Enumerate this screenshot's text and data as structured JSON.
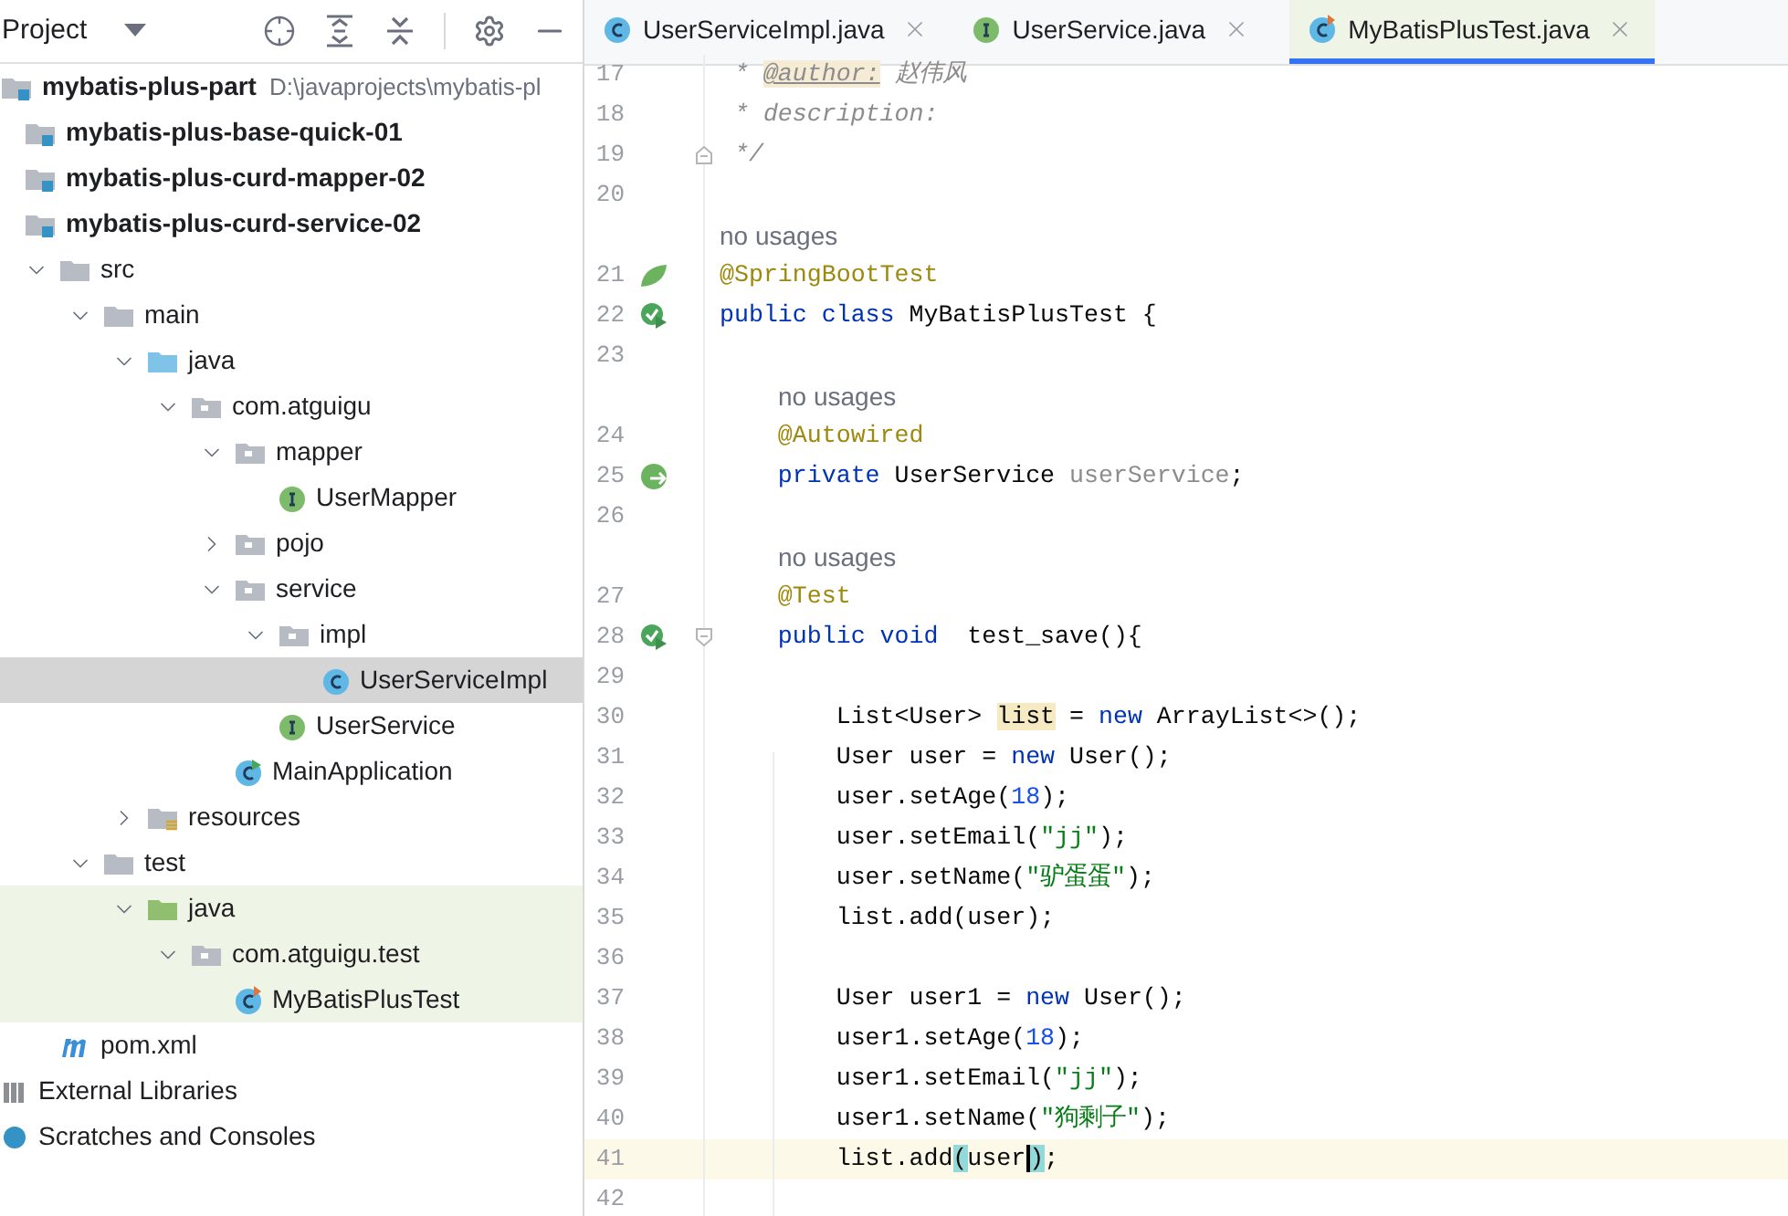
{
  "project_panel": {
    "title": "Project",
    "tree": [
      {
        "label": "mybatis-plus-part",
        "path": "D:\\javaprojects\\mybatis-pl",
        "kind": "root",
        "selected": false,
        "children": [
          {
            "label": "mybatis-plus-base-quick-01",
            "kind": "module",
            "selected": false
          },
          {
            "label": "mybatis-plus-curd-mapper-02",
            "kind": "module",
            "selected": false
          },
          {
            "label": "mybatis-plus-curd-service-02",
            "kind": "module",
            "selected": false
          },
          {
            "label": "src",
            "kind": "folder",
            "expanded": true,
            "selected": false,
            "children": [
              {
                "label": "main",
                "kind": "folder",
                "expanded": true,
                "selected": false,
                "children": [
                  {
                    "label": "java",
                    "kind": "source-folder",
                    "expanded": true,
                    "selected": false,
                    "children": [
                      {
                        "label": "com.atguigu",
                        "kind": "package",
                        "expanded": true,
                        "selected": false,
                        "children": [
                          {
                            "label": "mapper",
                            "kind": "package",
                            "expanded": true,
                            "selected": false,
                            "children": [
                              {
                                "label": "UserMapper",
                                "kind": "interface",
                                "selected": false
                              }
                            ]
                          },
                          {
                            "label": "pojo",
                            "kind": "package",
                            "expanded": false,
                            "selected": false
                          },
                          {
                            "label": "service",
                            "kind": "package",
                            "expanded": true,
                            "selected": false,
                            "children": [
                              {
                                "label": "impl",
                                "kind": "package",
                                "expanded": true,
                                "selected": false,
                                "children": [
                                  {
                                    "label": "UserServiceImpl",
                                    "kind": "class",
                                    "selected": true
                                  }
                                ]
                              },
                              {
                                "label": "UserService",
                                "kind": "interface",
                                "selected": false
                              }
                            ]
                          },
                          {
                            "label": "MainApplication",
                            "kind": "spring-class",
                            "selected": false
                          }
                        ]
                      }
                    ]
                  },
                  {
                    "label": "resources",
                    "kind": "resources-folder",
                    "expanded": false,
                    "selected": false
                  }
                ]
              },
              {
                "label": "test",
                "kind": "folder",
                "expanded": true,
                "selected": false,
                "children": [
                  {
                    "label": "java",
                    "kind": "test-folder",
                    "expanded": true,
                    "selected": false,
                    "children": [
                      {
                        "label": "com.atguigu.test",
                        "kind": "package",
                        "expanded": true,
                        "selected": false,
                        "children": [
                          {
                            "label": "MyBatisPlusTest",
                            "kind": "test-class",
                            "selected": false
                          }
                        ]
                      }
                    ]
                  }
                ]
              }
            ]
          },
          {
            "label": "pom.xml",
            "kind": "maven",
            "selected": false
          }
        ]
      },
      {
        "label": "External Libraries",
        "kind": "libraries",
        "selected": false
      },
      {
        "label": "Scratches and Consoles",
        "kind": "scratches",
        "selected": false
      }
    ]
  },
  "tabs": [
    {
      "label": "UserServiceImpl.java",
      "kind": "class",
      "selected": false
    },
    {
      "label": "UserService.java",
      "kind": "interface",
      "selected": false
    },
    {
      "label": "MyBatisPlusTest.java",
      "kind": "test-class",
      "selected": true
    }
  ],
  "editor": {
    "lines": [
      {
        "kind": "code",
        "number": "17",
        "current": false,
        "tokens": [
          {
            "text": " * ",
            "kind": "comment"
          },
          {
            "text": "@author:",
            "kind": "doctag"
          },
          {
            "text": " 赵伟风",
            "kind": "comment"
          }
        ]
      },
      {
        "kind": "code",
        "number": "18",
        "current": false,
        "tokens": [
          {
            "text": " * description:",
            "kind": "comment"
          }
        ]
      },
      {
        "kind": "code",
        "number": "19",
        "current": false,
        "fold_marker": {
          "kind": "end"
        },
        "tokens": [
          {
            "text": " */",
            "kind": "comment"
          }
        ]
      },
      {
        "kind": "code",
        "number": "20"
      },
      {
        "kind": "hint",
        "text": "no usages"
      },
      {
        "kind": "code",
        "number": "21",
        "current": false,
        "gutter_icon": {
          "kind": "spring"
        },
        "tokens": [
          {
            "text": "@SpringBootTest",
            "kind": "annotation"
          }
        ]
      },
      {
        "kind": "code",
        "number": "22",
        "current": false,
        "gutter_icon": {
          "kind": "run"
        },
        "tokens": [
          {
            "text": "public class",
            "kind": "keyword"
          },
          {
            "text": " MyBatisPlusTest {",
            "kind": "plain"
          }
        ]
      },
      {
        "kind": "code",
        "number": "23"
      },
      {
        "kind": "hint",
        "text": "no usages"
      },
      {
        "kind": "code",
        "number": "24",
        "current": false,
        "tokens": [
          {
            "text": "    @Autowired",
            "kind": "annotation"
          }
        ]
      },
      {
        "kind": "code",
        "number": "25",
        "current": false,
        "gutter_icon": {
          "kind": "bean"
        },
        "tokens": [
          {
            "text": "    private",
            "kind": "keyword"
          },
          {
            "text": " UserService ",
            "kind": "plain"
          },
          {
            "text": "userService",
            "kind": "unused"
          },
          {
            "text": ";",
            "kind": "plain"
          }
        ]
      },
      {
        "kind": "code",
        "number": "26"
      },
      {
        "kind": "hint",
        "text": "no usages"
      },
      {
        "kind": "code",
        "number": "27",
        "current": false,
        "tokens": [
          {
            "text": "    @Test",
            "kind": "annotation"
          }
        ]
      },
      {
        "kind": "code",
        "number": "28",
        "current": false,
        "gutter_icon": {
          "kind": "run"
        },
        "fold_marker": {
          "kind": "start"
        },
        "tokens": [
          {
            "text": "    public void",
            "kind": "keyword"
          },
          {
            "text": "  test_save(){",
            "kind": "plain"
          }
        ]
      },
      {
        "kind": "code",
        "number": "29"
      },
      {
        "kind": "code",
        "number": "30",
        "current": false,
        "tokens": [
          {
            "text": "        List<User> ",
            "kind": "plain"
          },
          {
            "text": "list",
            "kind": "highlight"
          },
          {
            "text": " = ",
            "kind": "plain"
          },
          {
            "text": "new",
            "kind": "keyword"
          },
          {
            "text": " ArrayList<>();",
            "kind": "plain"
          }
        ]
      },
      {
        "kind": "code",
        "number": "31",
        "current": false,
        "tokens": [
          {
            "text": "        User user = ",
            "kind": "plain"
          },
          {
            "text": "new",
            "kind": "keyword"
          },
          {
            "text": " User();",
            "kind": "plain"
          }
        ]
      },
      {
        "kind": "code",
        "number": "32",
        "current": false,
        "tokens": [
          {
            "text": "        user.setAge(",
            "kind": "plain"
          },
          {
            "text": "18",
            "kind": "number"
          },
          {
            "text": ");",
            "kind": "plain"
          }
        ]
      },
      {
        "kind": "code",
        "number": "33",
        "current": false,
        "tokens": [
          {
            "text": "        user.setEmail(",
            "kind": "plain"
          },
          {
            "text": "\"jj\"",
            "kind": "string"
          },
          {
            "text": ");",
            "kind": "plain"
          }
        ]
      },
      {
        "kind": "code",
        "number": "34",
        "current": false,
        "tokens": [
          {
            "text": "        user.setName(",
            "kind": "plain"
          },
          {
            "text": "\"驴蛋蛋\"",
            "kind": "string"
          },
          {
            "text": ");",
            "kind": "plain"
          }
        ]
      },
      {
        "kind": "code",
        "number": "35",
        "current": false,
        "tokens": [
          {
            "text": "        list.add(user);",
            "kind": "plain"
          }
        ]
      },
      {
        "kind": "code",
        "number": "36"
      },
      {
        "kind": "code",
        "number": "37",
        "current": false,
        "tokens": [
          {
            "text": "        User user1 = ",
            "kind": "plain"
          },
          {
            "text": "new",
            "kind": "keyword"
          },
          {
            "text": " User();",
            "kind": "plain"
          }
        ]
      },
      {
        "kind": "code",
        "number": "38",
        "current": false,
        "tokens": [
          {
            "text": "        user1.setAge(",
            "kind": "plain"
          },
          {
            "text": "18",
            "kind": "number"
          },
          {
            "text": ");",
            "kind": "plain"
          }
        ]
      },
      {
        "kind": "code",
        "number": "39",
        "current": false,
        "tokens": [
          {
            "text": "        user1.setEmail(",
            "kind": "plain"
          },
          {
            "text": "\"jj\"",
            "kind": "string"
          },
          {
            "text": ");",
            "kind": "plain"
          }
        ]
      },
      {
        "kind": "code",
        "number": "40",
        "current": false,
        "tokens": [
          {
            "text": "        user1.setName(",
            "kind": "plain"
          },
          {
            "text": "\"狗剩子\"",
            "kind": "string"
          },
          {
            "text": ");",
            "kind": "plain"
          }
        ]
      },
      {
        "kind": "code",
        "number": "41",
        "current": true,
        "tokens": [
          {
            "text": "        list.add",
            "kind": "plain"
          },
          {
            "text": "(",
            "kind": "brace"
          },
          {
            "text": "user",
            "kind": "plain"
          },
          {
            "text": ")",
            "kind": "caret"
          },
          {
            "text": ";",
            "kind": "plain"
          }
        ]
      },
      {
        "kind": "code",
        "number": "42"
      }
    ]
  }
}
